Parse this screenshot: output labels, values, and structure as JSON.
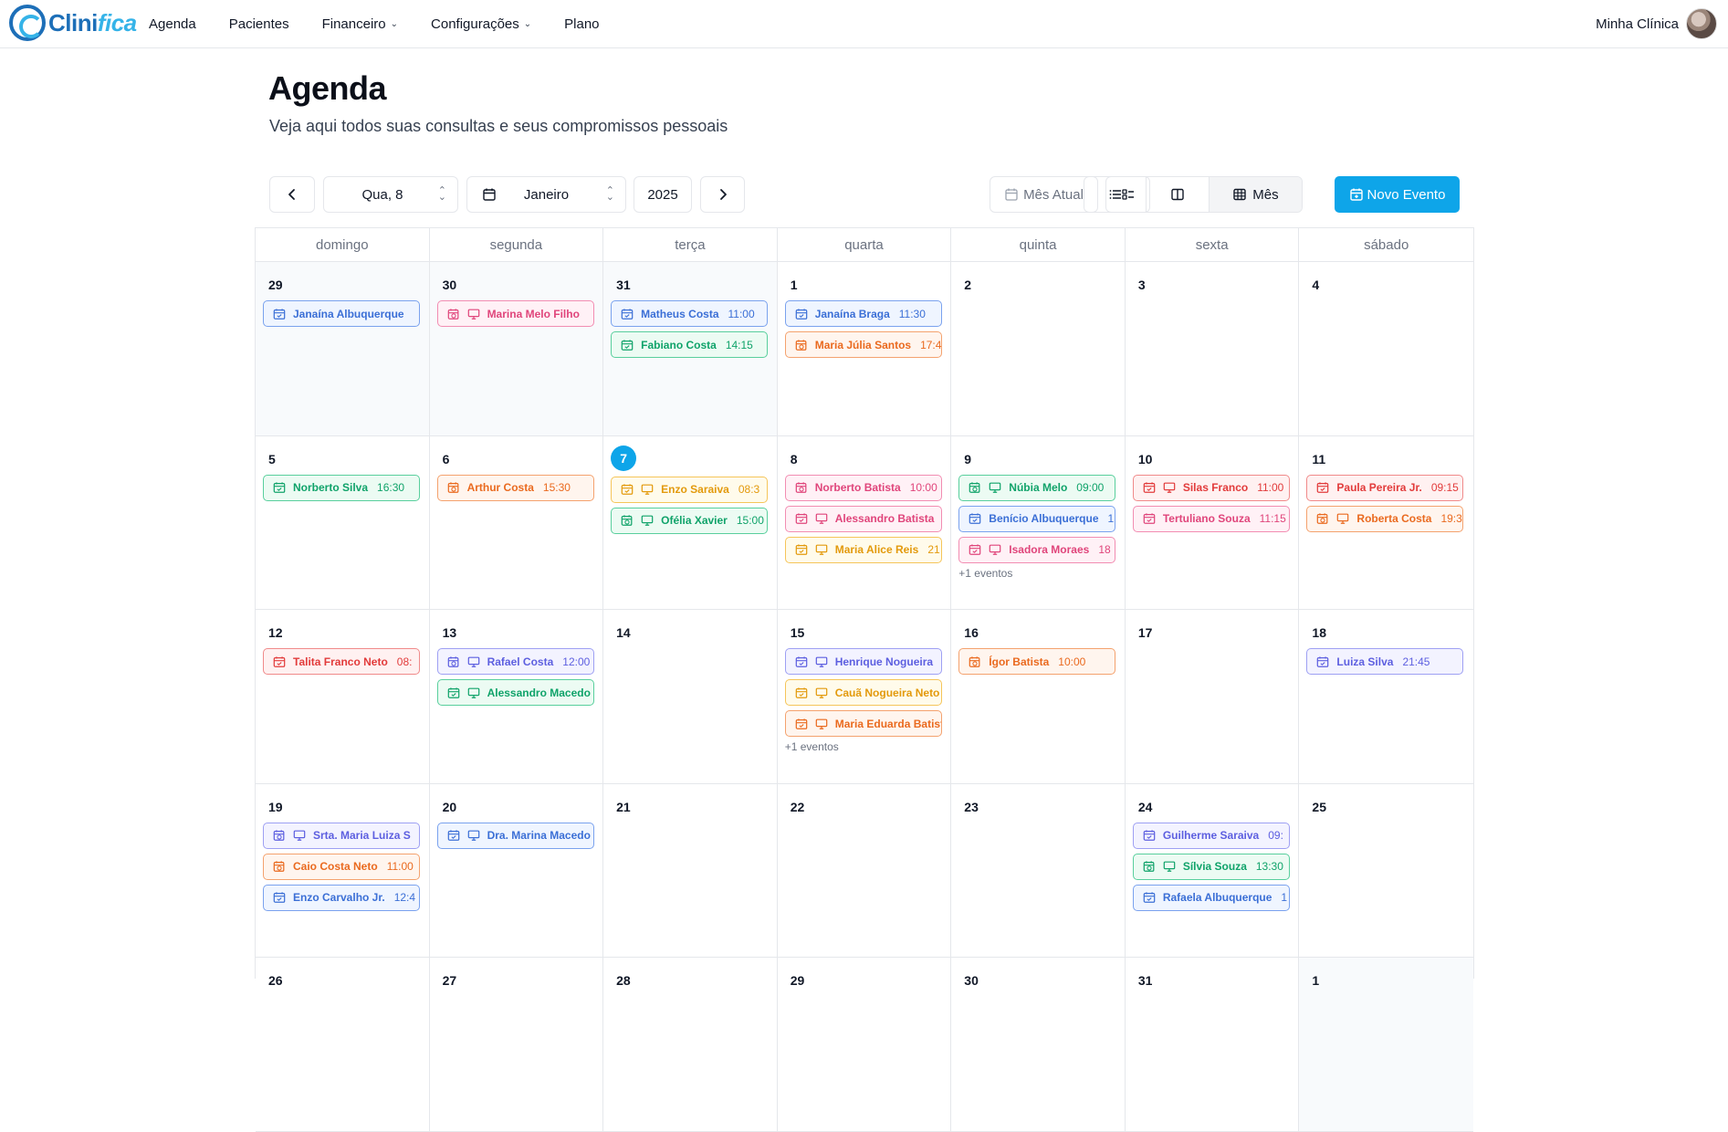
{
  "app": {
    "logo_main": "Clini",
    "logo_accent": "fica"
  },
  "nav": {
    "items": [
      {
        "label": "Agenda",
        "dropdown": false
      },
      {
        "label": "Pacientes",
        "dropdown": false
      },
      {
        "label": "Financeiro",
        "dropdown": true
      },
      {
        "label": "Configurações",
        "dropdown": true
      },
      {
        "label": "Plano",
        "dropdown": false
      }
    ],
    "user_name": "Minha Clínica"
  },
  "header": {
    "title": "Agenda",
    "subtitle": "Veja aqui todos suas consultas e seus compromissos pessoais"
  },
  "toolbar": {
    "prev_icon": "chevron-left-icon",
    "day_label": "Qua, 8",
    "month_label": "Janeiro",
    "year_label": "2025",
    "next_icon": "chevron-right-icon",
    "current_month_label": "Mês Atual",
    "view_month_label": "Mês",
    "new_event_label": "Novo Evento"
  },
  "calendar": {
    "weekdays": [
      "domingo",
      "segunda",
      "terça",
      "quarta",
      "quinta",
      "sexta",
      "sábado"
    ],
    "today": 7,
    "days": [
      {
        "n": "29",
        "outside": true,
        "events": [
          {
            "name": "Janaína Albuquerque",
            "time": "",
            "color": "blue",
            "icons": [
              "calendar"
            ]
          }
        ]
      },
      {
        "n": "30",
        "outside": true,
        "events": [
          {
            "name": "Marina Melo Filho",
            "time": "",
            "color": "pink",
            "icons": [
              "calendar-clock",
              "monitor"
            ]
          }
        ]
      },
      {
        "n": "31",
        "outside": true,
        "events": [
          {
            "name": "Matheus Costa",
            "time": "11:00",
            "color": "blue",
            "icons": [
              "calendar"
            ]
          },
          {
            "name": "Fabiano Costa",
            "time": "14:15",
            "color": "green",
            "icons": [
              "calendar"
            ]
          }
        ]
      },
      {
        "n": "1",
        "outside": false,
        "events": [
          {
            "name": "Janaína Braga",
            "time": "11:30",
            "color": "blue",
            "icons": [
              "calendar"
            ]
          },
          {
            "name": "Maria Júlia Santos",
            "time": "17:4",
            "color": "orange",
            "icons": [
              "calendar-clock"
            ]
          }
        ]
      },
      {
        "n": "2",
        "outside": false,
        "events": []
      },
      {
        "n": "3",
        "outside": false,
        "events": []
      },
      {
        "n": "4",
        "outside": false,
        "events": []
      },
      {
        "n": "5",
        "outside": false,
        "events": [
          {
            "name": "Norberto Silva",
            "time": "16:30",
            "color": "green",
            "icons": [
              "calendar"
            ]
          }
        ]
      },
      {
        "n": "6",
        "outside": false,
        "events": [
          {
            "name": "Arthur Costa",
            "time": "15:30",
            "color": "orange",
            "icons": [
              "calendar-clock"
            ]
          }
        ]
      },
      {
        "n": "7",
        "outside": false,
        "events": [
          {
            "name": "Enzo Saraiva",
            "time": "08:3",
            "color": "amber",
            "icons": [
              "calendar",
              "monitor"
            ]
          },
          {
            "name": "Ofélia Xavier",
            "time": "15:00",
            "color": "green",
            "icons": [
              "calendar-clock",
              "monitor"
            ]
          }
        ]
      },
      {
        "n": "8",
        "outside": false,
        "events": [
          {
            "name": "Norberto Batista",
            "time": "10:00",
            "color": "pink",
            "icons": [
              "calendar-clock"
            ]
          },
          {
            "name": "Alessandro Batista",
            "time": "",
            "color": "pink",
            "icons": [
              "calendar",
              "monitor"
            ]
          },
          {
            "name": "Maria Alice Reis",
            "time": "21",
            "color": "amber",
            "icons": [
              "calendar",
              "monitor"
            ]
          }
        ]
      },
      {
        "n": "9",
        "outside": false,
        "more": "+1 eventos",
        "events": [
          {
            "name": "Núbia Melo",
            "time": "09:00",
            "color": "green",
            "icons": [
              "calendar-clock",
              "monitor"
            ]
          },
          {
            "name": "Benício Albuquerque",
            "time": "1",
            "color": "blue",
            "icons": [
              "calendar"
            ]
          },
          {
            "name": "Isadora Moraes",
            "time": "18",
            "color": "pink",
            "icons": [
              "calendar",
              "monitor"
            ]
          }
        ]
      },
      {
        "n": "10",
        "outside": false,
        "events": [
          {
            "name": "Silas Franco",
            "time": "11:00",
            "color": "red",
            "icons": [
              "calendar",
              "monitor"
            ]
          },
          {
            "name": "Tertuliano Souza",
            "time": "11:15",
            "color": "pink",
            "icons": [
              "calendar"
            ]
          }
        ]
      },
      {
        "n": "11",
        "outside": false,
        "events": [
          {
            "name": "Paula Pereira Jr.",
            "time": "09:15",
            "color": "red",
            "icons": [
              "calendar"
            ]
          },
          {
            "name": "Roberta Costa",
            "time": "19:3",
            "color": "orange",
            "icons": [
              "calendar-clock",
              "monitor"
            ]
          }
        ]
      },
      {
        "n": "12",
        "outside": false,
        "events": [
          {
            "name": "Talita Franco Neto",
            "time": "08:",
            "color": "red",
            "icons": [
              "calendar"
            ]
          }
        ]
      },
      {
        "n": "13",
        "outside": false,
        "events": [
          {
            "name": "Rafael Costa",
            "time": "12:00",
            "color": "indigo",
            "icons": [
              "calendar-clock",
              "monitor"
            ]
          },
          {
            "name": "Alessandro Macedo",
            "time": "",
            "color": "green",
            "icons": [
              "calendar",
              "monitor"
            ]
          }
        ]
      },
      {
        "n": "14",
        "outside": false,
        "events": []
      },
      {
        "n": "15",
        "outside": false,
        "more": "+1 eventos",
        "events": [
          {
            "name": "Henrique Nogueira",
            "time": "",
            "color": "indigo",
            "icons": [
              "calendar",
              "monitor"
            ]
          },
          {
            "name": "Cauã Nogueira Neto",
            "time": "",
            "color": "amber",
            "icons": [
              "calendar",
              "monitor"
            ]
          },
          {
            "name": "Maria Eduarda Batista",
            "time": "",
            "color": "orange",
            "icons": [
              "calendar",
              "monitor"
            ]
          }
        ]
      },
      {
        "n": "16",
        "outside": false,
        "events": [
          {
            "name": "Ígor Batista",
            "time": "10:00",
            "color": "orange",
            "icons": [
              "calendar-clock"
            ]
          }
        ]
      },
      {
        "n": "17",
        "outside": false,
        "events": []
      },
      {
        "n": "18",
        "outside": false,
        "events": [
          {
            "name": "Luiza Silva",
            "time": "21:45",
            "color": "indigo",
            "icons": [
              "calendar"
            ]
          }
        ]
      },
      {
        "n": "19",
        "outside": false,
        "events": [
          {
            "name": "Srta. Maria Luiza S",
            "time": "",
            "color": "indigo",
            "icons": [
              "calendar-clock",
              "monitor"
            ]
          },
          {
            "name": "Caio Costa Neto",
            "time": "11:00",
            "color": "orange",
            "icons": [
              "calendar-clock"
            ]
          },
          {
            "name": "Enzo Carvalho Jr.",
            "time": "12:4",
            "color": "blue",
            "icons": [
              "calendar"
            ]
          }
        ]
      },
      {
        "n": "20",
        "outside": false,
        "events": [
          {
            "name": "Dra. Marina Macedo",
            "time": "",
            "color": "blue",
            "icons": [
              "calendar",
              "monitor"
            ]
          }
        ]
      },
      {
        "n": "21",
        "outside": false,
        "events": []
      },
      {
        "n": "22",
        "outside": false,
        "events": []
      },
      {
        "n": "23",
        "outside": false,
        "events": []
      },
      {
        "n": "24",
        "outside": false,
        "events": [
          {
            "name": "Guilherme Saraiva",
            "time": "09:",
            "color": "indigo",
            "icons": [
              "calendar"
            ]
          },
          {
            "name": "Sílvia Souza",
            "time": "13:30",
            "color": "green",
            "icons": [
              "calendar-clock",
              "monitor"
            ]
          },
          {
            "name": "Rafaela Albuquerque",
            "time": "1",
            "color": "blue",
            "icons": [
              "calendar"
            ]
          }
        ]
      },
      {
        "n": "25",
        "outside": false,
        "events": []
      },
      {
        "n": "26",
        "outside": false,
        "events": []
      },
      {
        "n": "27",
        "outside": false,
        "events": []
      },
      {
        "n": "28",
        "outside": false,
        "events": []
      },
      {
        "n": "29",
        "outside": false,
        "events": []
      },
      {
        "n": "30",
        "outside": false,
        "events": []
      },
      {
        "n": "31",
        "outside": false,
        "events": []
      },
      {
        "n": "1",
        "outside": true,
        "events": []
      }
    ]
  }
}
